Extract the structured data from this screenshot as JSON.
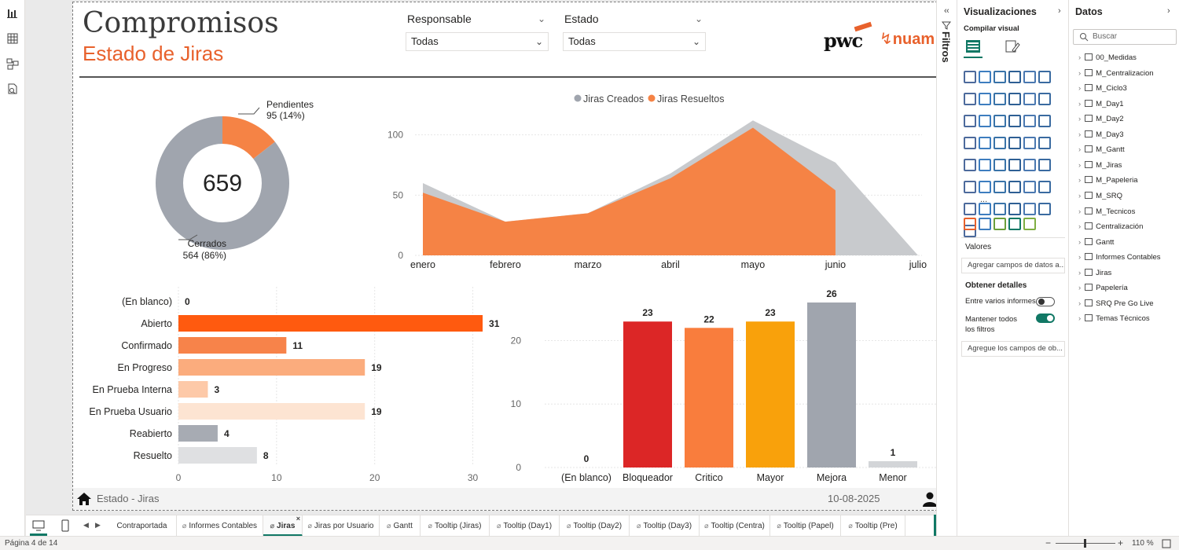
{
  "header": {
    "title": "Compromisos",
    "subtitle": "Estado de Jiras",
    "logo_primary": "pwc",
    "logo_secondary": "nuam"
  },
  "slicers": [
    {
      "label": "Responsable",
      "value": "Todas"
    },
    {
      "label": "Estado",
      "value": "Todas"
    }
  ],
  "donut": {
    "center_value": "659",
    "segments": [
      {
        "name": "Pendientes",
        "label": "95 (14%)",
        "value": 95,
        "color": "#f58345"
      },
      {
        "name": "Cerrados",
        "label": "564 (86%)",
        "value": 564,
        "color": "#a0a5ae"
      }
    ]
  },
  "chart_data": [
    {
      "type": "area",
      "x": [
        "enero",
        "febrero",
        "marzo",
        "abril",
        "mayo",
        "junio",
        "julio"
      ],
      "series": [
        {
          "name": "Jiras Creados",
          "color": "#c8cacd",
          "values": [
            60,
            28,
            35,
            68,
            112,
            77,
            0
          ]
        },
        {
          "name": "Jiras Resueltos",
          "color": "#f58345",
          "values": [
            52,
            28,
            35,
            64,
            106,
            54,
            null
          ]
        }
      ],
      "yticks": [
        0,
        50,
        100
      ],
      "ylim": [
        0,
        120
      ],
      "legend": "top"
    },
    {
      "type": "bar",
      "orientation": "horizontal",
      "categories": [
        "(En blanco)",
        "Abierto",
        "Confirmado",
        "En Progreso",
        "En Prueba Interna",
        "En Prueba Usuario",
        "Reabierto",
        "Resuelto"
      ],
      "values": [
        0,
        31,
        11,
        19,
        3,
        19,
        4,
        8
      ],
      "colors": [
        "#ff5a0f",
        "#ff5a0f",
        "#f7834a",
        "#fbac7d",
        "#fdc9a8",
        "#fde4d2",
        "#a7abb3",
        "#dfe0e2"
      ],
      "xticks": [
        0,
        10,
        20,
        30
      ],
      "xlim": [
        0,
        33
      ]
    },
    {
      "type": "bar",
      "categories": [
        "(En blanco)",
        "Bloqueador",
        "Critico",
        "Mayor",
        "Mejora",
        "Menor"
      ],
      "values": [
        0,
        23,
        22,
        23,
        26,
        1
      ],
      "colors": [
        "#cccccc",
        "#dc2626",
        "#f97d3d",
        "#f9a10b",
        "#a0a5ae",
        "#d3d5d8"
      ],
      "yticks": [
        0,
        10,
        20
      ],
      "ylim": [
        0,
        26
      ]
    }
  ],
  "footer": {
    "page_name": "Estado - Jiras",
    "date": "10-08-2025"
  },
  "tabs": [
    {
      "label": "Contraportada",
      "hidden": false,
      "active": false
    },
    {
      "label": "Informes Contables",
      "hidden": true,
      "active": false
    },
    {
      "label": "Jiras",
      "hidden": true,
      "active": true
    },
    {
      "label": "Jiras por Usuario",
      "hidden": true,
      "active": false
    },
    {
      "label": "Gantt",
      "hidden": true,
      "active": false
    },
    {
      "label": "Tooltip (Jiras)",
      "hidden": true,
      "active": false
    },
    {
      "label": "Tooltip (Day1)",
      "hidden": true,
      "active": false
    },
    {
      "label": "Tooltip (Day2)",
      "hidden": true,
      "active": false
    },
    {
      "label": "Tooltip (Day3)",
      "hidden": true,
      "active": false
    },
    {
      "label": "Tooltip (Centra)",
      "hidden": true,
      "active": false
    },
    {
      "label": "Tooltip (Papel)",
      "hidden": true,
      "active": false
    },
    {
      "label": "Tooltip (Pre)",
      "hidden": true,
      "active": false
    }
  ],
  "active_tab_close": "×",
  "add_tab": "+",
  "status": {
    "page": "Página 4 de 14",
    "zoom": "110 %",
    "zoom_minus": "−",
    "zoom_plus": "+"
  },
  "filters_pane": {
    "label": "Filtros"
  },
  "viz_pane": {
    "title": "Visualizaciones",
    "build_label": "Compilar visual",
    "more": "...",
    "values_label": "Valores",
    "values_placeholder": "Agregar campos de datos a...",
    "drill_label": "Obtener detalles",
    "cross_report": "Entre varios informes",
    "cross_report_on": false,
    "keep_filters": "Mantener todos los filtros",
    "keep_filters_on": true,
    "drill_placeholder": "Agregue los campos de ob..."
  },
  "data_pane": {
    "title": "Datos",
    "search_placeholder": "Buscar",
    "tables": [
      {
        "name": "00_Medidas",
        "kind": "measure"
      },
      {
        "name": "M_Centralizacion",
        "kind": "measure"
      },
      {
        "name": "M_Ciclo3",
        "kind": "measure"
      },
      {
        "name": "M_Day1",
        "kind": "measure"
      },
      {
        "name": "M_Day2",
        "kind": "measure"
      },
      {
        "name": "M_Day3",
        "kind": "measure"
      },
      {
        "name": "M_Gantt",
        "kind": "measure"
      },
      {
        "name": "M_Jiras",
        "kind": "measure"
      },
      {
        "name": "M_Papeleria",
        "kind": "measure"
      },
      {
        "name": "M_SRQ",
        "kind": "measure"
      },
      {
        "name": "M_Tecnicos",
        "kind": "measure"
      },
      {
        "name": "Centralización",
        "kind": "table"
      },
      {
        "name": "Gantt",
        "kind": "table"
      },
      {
        "name": "Informes Contables",
        "kind": "table"
      },
      {
        "name": "Jiras",
        "kind": "table"
      },
      {
        "name": "Papelería",
        "kind": "table"
      },
      {
        "name": "SRQ Pre Go Live",
        "kind": "table"
      },
      {
        "name": "Temas Técnicos",
        "kind": "table"
      }
    ]
  },
  "icons": {
    "rail": [
      "report-view-icon",
      "table-view-icon",
      "model-view-icon",
      "dax-query-icon"
    ],
    "footer_home": "home-icon",
    "footer_user": "user-icon"
  }
}
